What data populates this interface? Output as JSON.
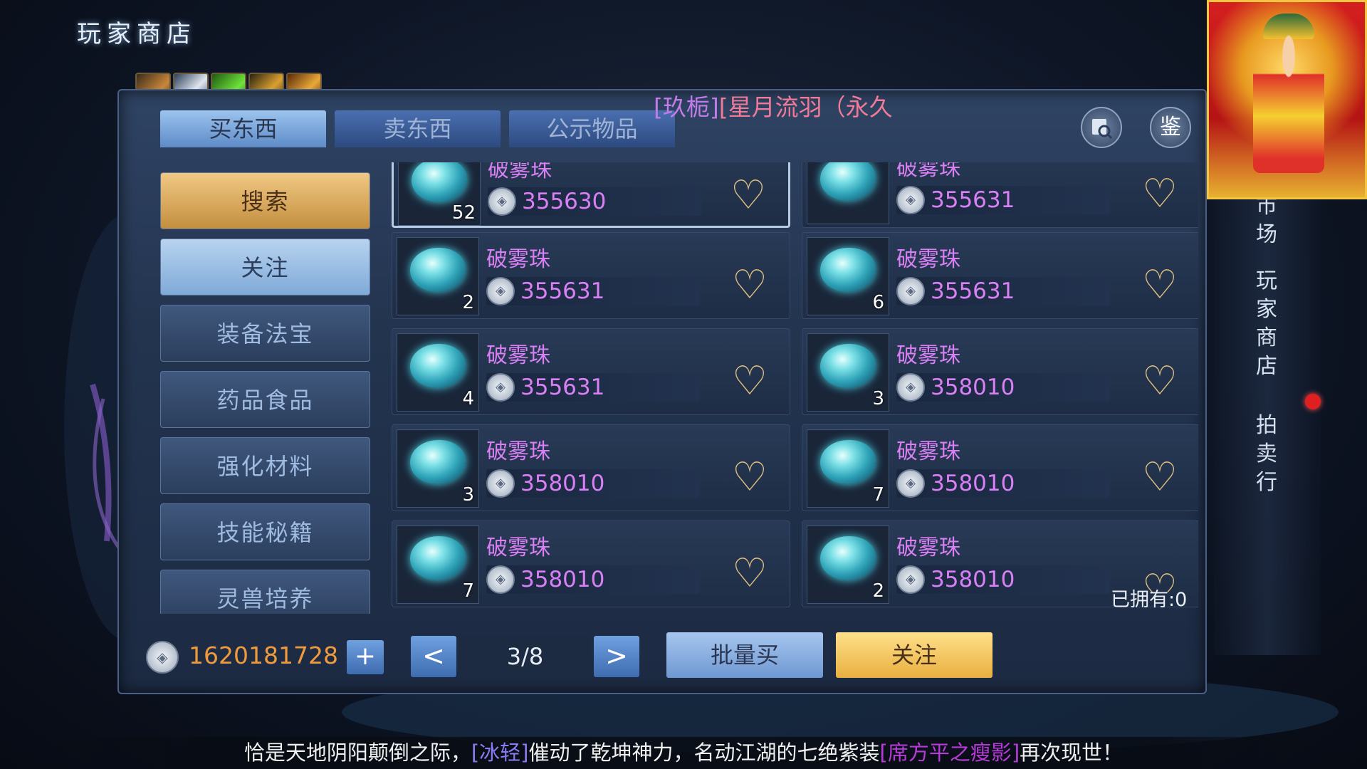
{
  "header": {
    "title": "玩家商店"
  },
  "buff_icons": [
    "fire-buff-icon",
    "flask-buff-icon",
    "green-scroll-buff-icon",
    "dragon-buff-icon",
    "warrior-buff-icon"
  ],
  "tabs": [
    {
      "label": "买东西",
      "active": true
    },
    {
      "label": "卖东西",
      "active": false
    },
    {
      "label": "公示物品",
      "active": false
    }
  ],
  "notice": {
    "part1": "[玖栀]",
    "part2": "[星月流羽（永久"
  },
  "toolbar": {
    "search_icon_label": "",
    "identify_label": "鉴"
  },
  "categories": [
    {
      "label": "搜索",
      "style": "search"
    },
    {
      "label": "关注",
      "style": "follow"
    },
    {
      "label": "装备法宝",
      "style": "normal"
    },
    {
      "label": "药品食品",
      "style": "normal"
    },
    {
      "label": "强化材料",
      "style": "normal"
    },
    {
      "label": "技能秘籍",
      "style": "normal"
    },
    {
      "label": "灵兽培养",
      "style": "normal"
    }
  ],
  "scroll_indicator": "⌄",
  "listings": [
    {
      "name": "破雾珠",
      "count": "52",
      "price": "355630",
      "selected": true
    },
    {
      "name": "破雾珠",
      "count": "",
      "price": "355631",
      "selected": false
    },
    {
      "name": "破雾珠",
      "count": "2",
      "price": "355631",
      "selected": false
    },
    {
      "name": "破雾珠",
      "count": "6",
      "price": "355631",
      "selected": false
    },
    {
      "name": "破雾珠",
      "count": "4",
      "price": "355631",
      "selected": false
    },
    {
      "name": "破雾珠",
      "count": "3",
      "price": "358010",
      "selected": false
    },
    {
      "name": "破雾珠",
      "count": "3",
      "price": "358010",
      "selected": false
    },
    {
      "name": "破雾珠",
      "count": "7",
      "price": "358010",
      "selected": false
    },
    {
      "name": "破雾珠",
      "count": "7",
      "price": "358010",
      "selected": false
    },
    {
      "name": "破雾珠",
      "count": "2",
      "price": "358010",
      "selected": false
    }
  ],
  "owned": "已拥有:0",
  "wallet": {
    "amount": "1620181728",
    "add_label": "+",
    "coin_glyph": "◈"
  },
  "pagination": {
    "prev_label": "<",
    "page": "3/8",
    "next_label": ">"
  },
  "actions": {
    "bulk_buy_label": "批量买",
    "follow_label": "关注"
  },
  "side_nav": {
    "market_partial": "市\n场",
    "player_shop": "玩\n家\n商\n店",
    "auction": "拍\n卖\n行"
  },
  "broadcast": {
    "prefix": "恰是天地阴阳颠倒之际，",
    "player": "[冰轻]",
    "middle": "催动了乾坤神力，名动江湖的七绝紫装",
    "item": "[席方平之瘦影]",
    "suffix": "再次现世！"
  },
  "colors": {
    "price_text": "#d980f5",
    "money_text": "#ef9a3c",
    "search_button": "#e0b060",
    "follow_button": "#f0c050",
    "bulk_button": "#8fb3e6"
  }
}
